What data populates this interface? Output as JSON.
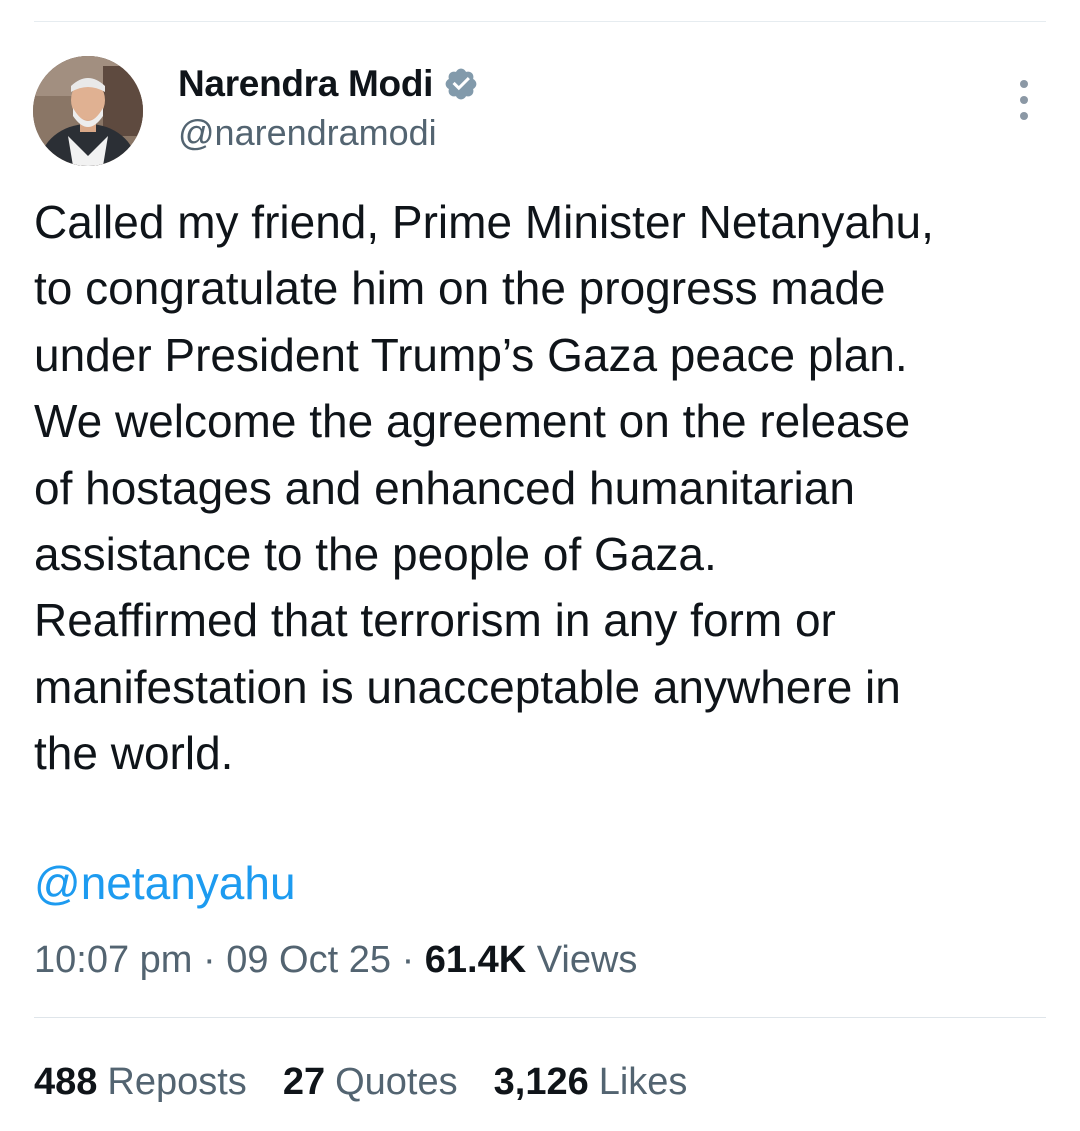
{
  "author": {
    "name": "Narendra Modi",
    "handle": "@narendramodi",
    "verified_icon": "verified-badge-icon",
    "badge_color": "#829aab"
  },
  "tweet": {
    "text": "Called my friend, Prime Minister Netanyahu,\nto congratulate him on the progress made\nunder President Trump’s Gaza peace plan.\nWe welcome the agreement on the release\nof hostages and enhanced humanitarian\nassistance to the people of Gaza.\nReaffirmed that terrorism in any form or\nmanifestation is unacceptable anywhere in\nthe world.",
    "mention": "@netanyahu",
    "mention_color": "#1d9bf0"
  },
  "meta": {
    "time": "10:07 pm",
    "separator": "·",
    "date": "09 Oct 25",
    "views_count": "61.4K",
    "views_label": "Views"
  },
  "stats": {
    "reposts_count": "488",
    "reposts_label": "Reposts",
    "quotes_count": "27",
    "quotes_label": "Quotes",
    "likes_count": "3,126",
    "likes_label": "Likes"
  },
  "icons": {
    "more": "more-vertical-icon"
  }
}
